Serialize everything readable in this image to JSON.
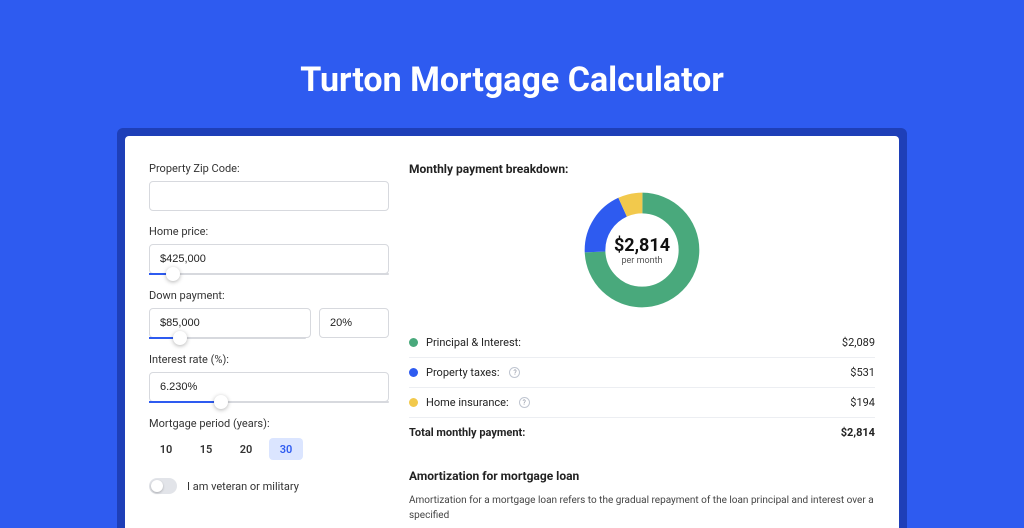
{
  "page_title": "Turton Mortgage Calculator",
  "form": {
    "zip_label": "Property Zip Code:",
    "zip_value": "",
    "home_price_label": "Home price:",
    "home_price_value": "$425,000",
    "home_price_slider_pct": 10,
    "down_payment_label": "Down payment:",
    "down_payment_value": "$85,000",
    "down_payment_pct": "20%",
    "down_payment_slider_pct": 20,
    "interest_label": "Interest rate (%):",
    "interest_value": "6.230%",
    "interest_slider_pct": 30,
    "period_label": "Mortgage period (years):",
    "period_options": [
      "10",
      "15",
      "20",
      "30"
    ],
    "period_active_index": 3,
    "veteran_label": "I am veteran or military",
    "veteran_on": false
  },
  "breakdown": {
    "title": "Monthly payment breakdown:",
    "donut_amount": "$2,814",
    "donut_per": "per month",
    "items": [
      {
        "label": "Principal & Interest:",
        "value": "$2,089",
        "color": "#49a97c",
        "info": false
      },
      {
        "label": "Property taxes:",
        "value": "$531",
        "color": "#2e5bf0",
        "info": true
      },
      {
        "label": "Home insurance:",
        "value": "$194",
        "color": "#f2c94c",
        "info": true
      }
    ],
    "total_label": "Total monthly payment:",
    "total_value": "$2,814"
  },
  "chart_data": {
    "type": "pie",
    "title": "Monthly payment breakdown",
    "categories": [
      "Principal & Interest",
      "Property taxes",
      "Home insurance"
    ],
    "values": [
      2089,
      531,
      194
    ],
    "colors": [
      "#49a97c",
      "#2e5bf0",
      "#f2c94c"
    ],
    "center_label": "$2,814 per month"
  },
  "amortization": {
    "title": "Amortization for mortgage loan",
    "body": "Amortization for a mortgage loan refers to the gradual repayment of the loan principal and interest over a specified"
  }
}
